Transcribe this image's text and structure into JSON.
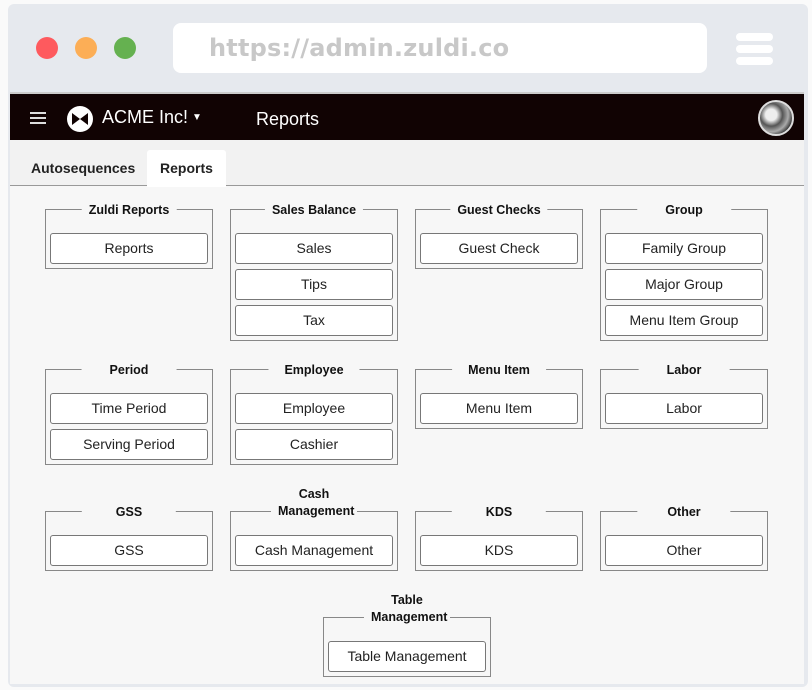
{
  "browser": {
    "url": "https://admin.zuldi.co"
  },
  "header": {
    "org_name": "ACME Inc!",
    "page_title": "Reports"
  },
  "tabs": [
    {
      "label": "Autosequences",
      "active": false
    },
    {
      "label": "Reports",
      "active": true
    }
  ],
  "groups": [
    {
      "title": "Zuldi Reports",
      "items": [
        "Reports"
      ]
    },
    {
      "title": "Sales Balance",
      "items": [
        "Sales",
        "Tips",
        "Tax"
      ]
    },
    {
      "title": "Guest Checks",
      "items": [
        "Guest Check"
      ]
    },
    {
      "title": "Group",
      "items": [
        "Family Group",
        "Major Group",
        "Menu Item Group"
      ]
    },
    {
      "title": "Period",
      "items": [
        "Time Period",
        "Serving Period"
      ]
    },
    {
      "title": "Employee",
      "items": [
        "Employee",
        "Cashier"
      ]
    },
    {
      "title": "Menu Item",
      "items": [
        "Menu Item"
      ]
    },
    {
      "title": "Labor",
      "items": [
        "Labor"
      ]
    },
    {
      "title": "GSS",
      "items": [
        "GSS"
      ]
    },
    {
      "title": "Cash Management",
      "items": [
        "Cash Management"
      ]
    },
    {
      "title": "KDS",
      "items": [
        "KDS"
      ]
    },
    {
      "title": "Other",
      "items": [
        "Other"
      ]
    },
    {
      "title": "Table Management",
      "items": [
        "Table Management"
      ]
    }
  ]
}
